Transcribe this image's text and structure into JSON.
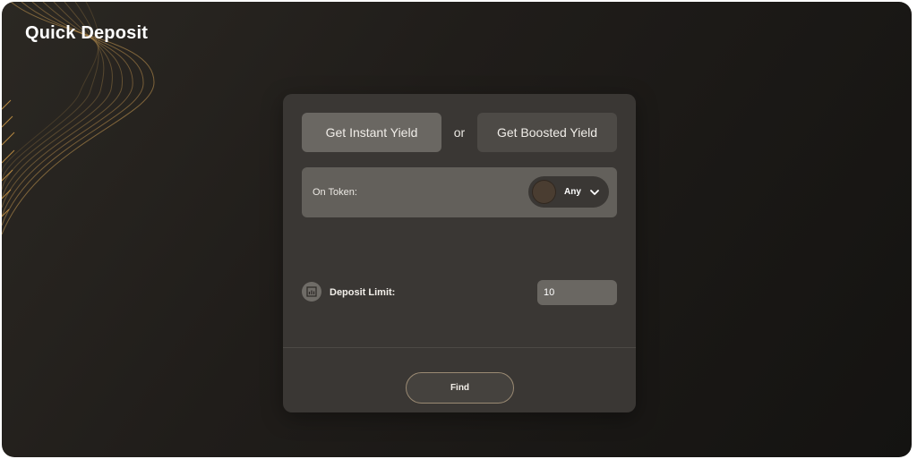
{
  "page": {
    "title": "Quick Deposit"
  },
  "mode_buttons": {
    "instant_label": "Get Instant Yield",
    "or_label": "or",
    "boosted_label": "Get Boosted Yield"
  },
  "token": {
    "label": "On Token:",
    "selected": "Any"
  },
  "deposit_limit": {
    "label": "Deposit Limit:",
    "value": "10"
  },
  "actions": {
    "find_label": "Find"
  },
  "colors": {
    "background": "#201d1a",
    "card": "#3a3734",
    "accent_gold": "#c99a52",
    "find_border": "#9a8a73"
  },
  "icons": {
    "token_dropdown": "chevron-down-icon",
    "deposit_limit": "chart-icon"
  }
}
